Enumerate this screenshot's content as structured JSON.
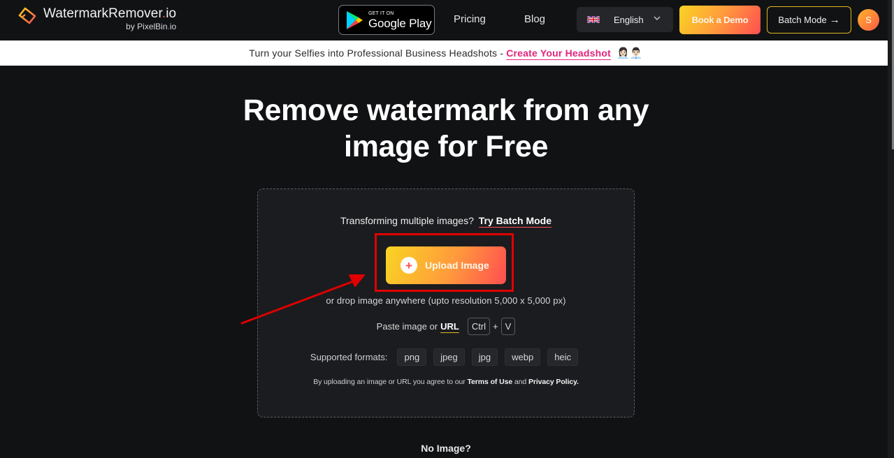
{
  "header": {
    "logo": {
      "title_main": "WatermarkRemover",
      "title_dot": ".",
      "title_tld": "io",
      "sub_prefix": "by PixelBin",
      "sub_dot": ".",
      "sub_tld": "io",
      "icon": "eraser-logo-icon"
    },
    "google_play": {
      "small": "GET IT ON",
      "big": "Google Play",
      "icon": "google-play-icon"
    },
    "nav": [
      {
        "label": "Pricing"
      },
      {
        "label": "Blog"
      }
    ],
    "language": {
      "label": "English",
      "flag": "uk-flag-icon",
      "chevron": "chevron-down-icon"
    },
    "book_demo_label": "Book a Demo",
    "batch_mode_label": "Batch Mode",
    "batch_mode_arrow": "→",
    "avatar_initial": "S"
  },
  "banner": {
    "text": "Turn your Selfies into Professional Business Headshots -",
    "link": "Create Your Headshot",
    "emoji": "👩🏻‍💼👨🏻‍💼"
  },
  "hero": {
    "title": "Remove watermark from any image for Free"
  },
  "upload_card": {
    "batch_prompt": "Transforming multiple images?",
    "batch_link": "Try Batch Mode",
    "upload_label": "Upload Image",
    "upload_plus": "+",
    "drop_text": "or drop image anywhere (upto resolution 5,000 x 5,000 px)",
    "paste_prefix": "Paste image or",
    "paste_url": "URL",
    "shortcut_keys": [
      "Ctrl",
      "V"
    ],
    "shortcut_plus": "+",
    "formats_label": "Supported formats:",
    "formats": [
      "png",
      "jpeg",
      "jpg",
      "webp",
      "heic"
    ],
    "terms": {
      "prefix": "By uploading an image or URL you agree to our",
      "terms_link": "Terms of Use",
      "and": "and",
      "privacy_link": "Privacy Policy."
    }
  },
  "below": {
    "no_image": "No Image?"
  },
  "colors": {
    "background": "#111214",
    "card": "#1b1c1f",
    "gradient_start": "#f9d423",
    "gradient_end": "#ff4e50",
    "banner_link": "#e2227a",
    "annotation_red": "#e00000"
  }
}
